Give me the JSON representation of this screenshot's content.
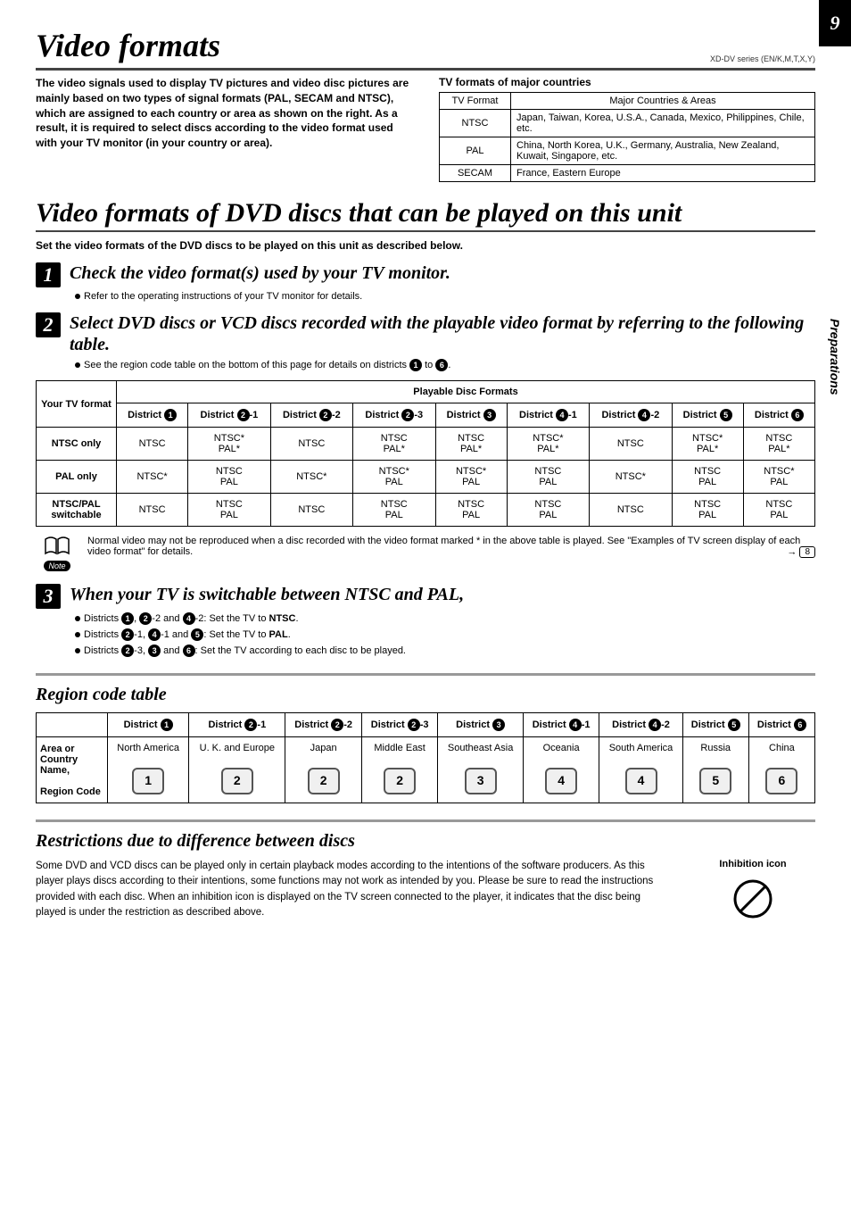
{
  "page_number": "9",
  "side_label": "Preparations",
  "doc_id": "XD-DV series (EN/K,M,T,X,Y)",
  "title1": "Video formats",
  "intro_text": "The video signals used to display TV pictures and video disc pictures are mainly based on two types of signal formats (PAL, SECAM and NTSC), which are assigned to each country or area as shown on the right. As a result, it is required to select discs according to the video format used with your TV monitor (in your country or area).",
  "tv_table": {
    "caption": "TV formats of major countries",
    "headers": [
      "TV Format",
      "Major Countries & Areas"
    ],
    "rows": [
      [
        "NTSC",
        "Japan, Taiwan, Korea, U.S.A., Canada, Mexico, Philippines, Chile, etc."
      ],
      [
        "PAL",
        "China, North Korea, U.K., Germany, Australia, New Zealand, Kuwait, Singapore, etc."
      ],
      [
        "SECAM",
        "France, Eastern Europe"
      ]
    ]
  },
  "title2": "Video formats of DVD discs that can be played on this unit",
  "set_line": "Set the video formats of the DVD discs to be played on this unit as described below.",
  "step1": {
    "num": "1",
    "title": "Check the video format(s) used by your TV monitor.",
    "body": "Refer to the operating instructions of your TV monitor for details."
  },
  "step2": {
    "num": "2",
    "title": "Select DVD discs or VCD discs recorded with the playable video format by referring to the following table.",
    "body_prefix": "See the region code table on the bottom of this page for details on districts ",
    "body_mid": " to ",
    "body_suffix": "."
  },
  "play_table": {
    "super_header": "Playable Disc Formats",
    "row_header_title": "Your TV format",
    "districts": [
      "1",
      "2",
      "2",
      "2",
      "3",
      "4",
      "4",
      "5",
      "6"
    ],
    "district_suffix": [
      "",
      "-1",
      "-2",
      "-3",
      "",
      "-1",
      "-2",
      "",
      ""
    ],
    "rows": [
      {
        "label": "NTSC only",
        "cells": [
          "NTSC",
          "NTSC*\nPAL*",
          "NTSC",
          "NTSC\nPAL*",
          "NTSC\nPAL*",
          "NTSC*\nPAL*",
          "NTSC",
          "NTSC*\nPAL*",
          "NTSC\nPAL*"
        ]
      },
      {
        "label": "PAL only",
        "cells": [
          "NTSC*",
          "NTSC\nPAL",
          "NTSC*",
          "NTSC*\nPAL",
          "NTSC*\nPAL",
          "NTSC\nPAL",
          "NTSC*",
          "NTSC\nPAL",
          "NTSC*\nPAL"
        ]
      },
      {
        "label": "NTSC/PAL switchable",
        "cells": [
          "NTSC",
          "NTSC\nPAL",
          "NTSC",
          "NTSC\nPAL",
          "NTSC\nPAL",
          "NTSC\nPAL",
          "NTSC",
          "NTSC\nPAL",
          "NTSC\nPAL"
        ]
      }
    ]
  },
  "note": {
    "label": "Note",
    "text_prefix": "Normal video may not be reproduced when a disc recorded with the video format marked * in the above table is played. See \"Examples of TV screen display of each video format\" for details.",
    "page_ref": "8"
  },
  "step3": {
    "num": "3",
    "title": "When your TV is switchable between NTSC and PAL,",
    "lines": [
      {
        "prefix": "Districts ",
        "d": [
          "1"
        ],
        "mid1": ", ",
        "d2": [
          "2"
        ],
        "s2": "-2 and ",
        "d3": [
          "4"
        ],
        "s3": "-2: Set the TV to ",
        "bold": "NTSC",
        "suffix": "."
      },
      {
        "prefix": "Districts ",
        "d": [
          "2"
        ],
        "s1": "-1, ",
        "d2": [
          "4"
        ],
        "s2": "-1 and ",
        "d3": [
          "5"
        ],
        "s3": ": Set the TV to ",
        "bold": "PAL",
        "suffix": "."
      },
      {
        "prefix": "Districts ",
        "d": [
          "2"
        ],
        "s1": "-3, ",
        "d2": [
          "3"
        ],
        "s2": " and ",
        "d3": [
          "6"
        ],
        "s3": ":  Set the TV according to each disc to be played.",
        "bold": "",
        "suffix": ""
      }
    ]
  },
  "region_heading": "Region code table",
  "region_table": {
    "row1_label": "Area or Country Name,",
    "row2_label": "Region Code",
    "districts": [
      "1",
      "2",
      "2",
      "2",
      "3",
      "4",
      "4",
      "5",
      "6"
    ],
    "district_suffix": [
      "",
      "-1",
      "-2",
      "-3",
      "",
      "-1",
      "-2",
      "",
      ""
    ],
    "areas": [
      "North America",
      "U. K. and Europe",
      "Japan",
      "Middle East",
      "Southeast Asia",
      "Oceania",
      "South America",
      "Russia",
      "China"
    ],
    "codes": [
      "1",
      "2",
      "2",
      "2",
      "3",
      "4",
      "4",
      "5",
      "6"
    ]
  },
  "restrict_heading": "Restrictions due to difference between discs",
  "restrict_text": "Some DVD and VCD discs can be played only in certain playback modes according to the intentions of the software producers. As this player plays discs according to their intentions, some functions may not work as intended by you. Please be sure to read the instructions provided with each disc. When an inhibition icon is displayed on the TV screen connected to the player, it indicates that the disc being played is under the restriction as described above.",
  "inhibition_label": "Inhibition icon"
}
